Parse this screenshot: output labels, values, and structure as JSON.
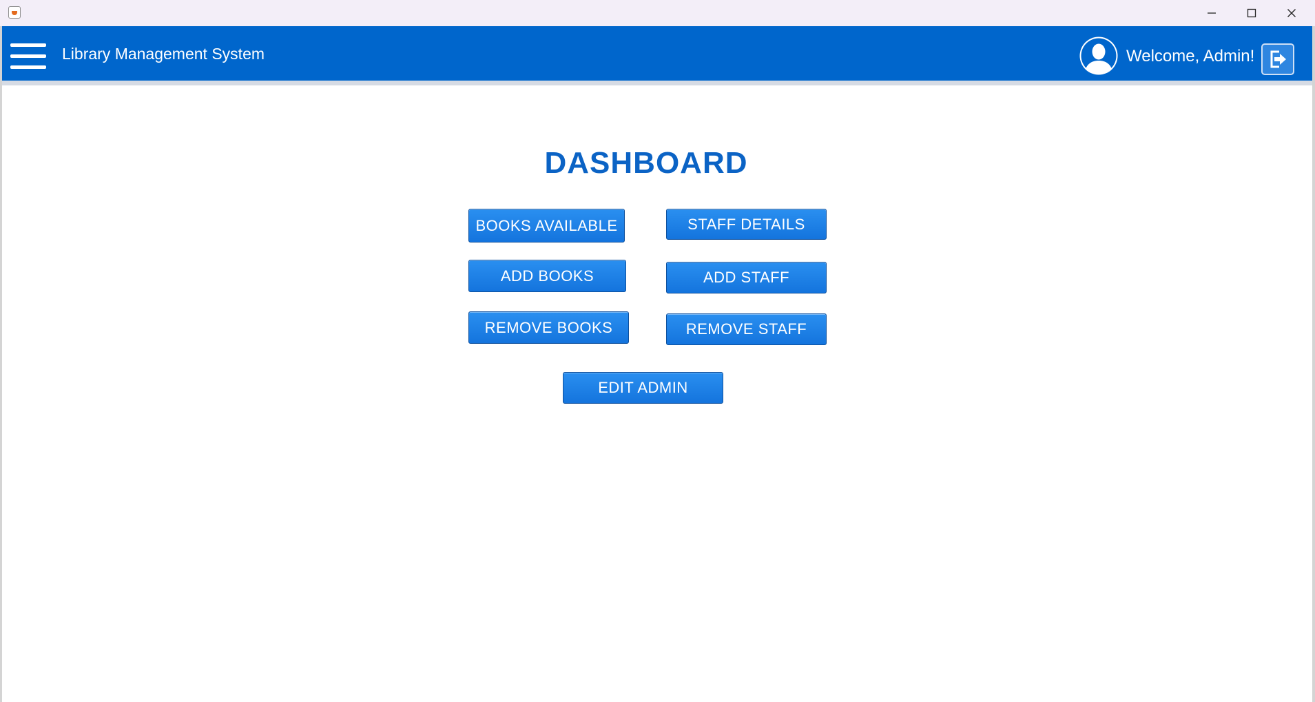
{
  "window": {
    "minimize_icon": "minimize-icon",
    "maximize_icon": "maximize-icon",
    "close_icon": "close-icon"
  },
  "header": {
    "title": "Library Management System",
    "welcome": "Welcome, Admin!",
    "menu_icon": "hamburger-menu-icon",
    "avatar_icon": "user-avatar-icon",
    "logout_icon": "logout-icon",
    "background_color": "#0066cc"
  },
  "dashboard": {
    "title": "DASHBOARD",
    "buttons": {
      "books_available": "BOOKS AVAILABLE",
      "staff_details": "STAFF DETAILS",
      "add_books": "ADD BOOKS",
      "add_staff": "ADD STAFF",
      "remove_books": "REMOVE BOOKS",
      "remove_staff": "REMOVE STAFF",
      "edit_admin": "EDIT ADMIN"
    },
    "button_color": "#1a7fe6",
    "title_color": "#0b63c5"
  }
}
